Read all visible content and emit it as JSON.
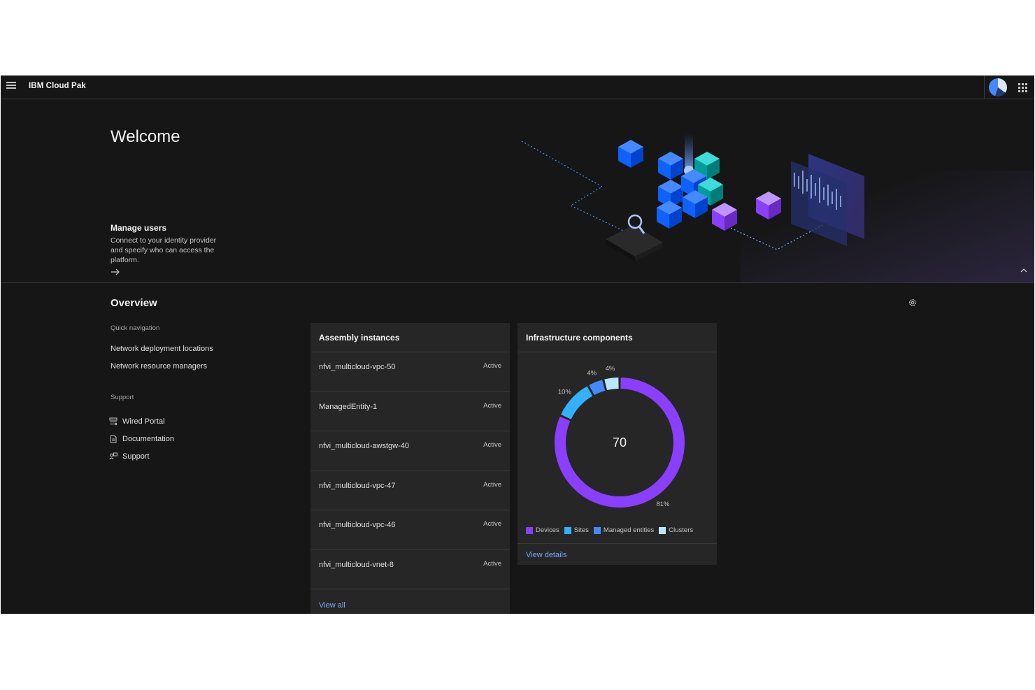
{
  "header": {
    "brand": "IBM Cloud Pak",
    "menu_icon": "hamburger-icon",
    "switcher_icon": "app-switcher-icon"
  },
  "banner": {
    "title": "Welcome",
    "manage_users": {
      "title": "Manage users",
      "description": "Connect to your identity provider and specify who can access the platform."
    }
  },
  "overview": {
    "title": "Overview",
    "quick_navigation": {
      "label": "Quick navigation",
      "links": [
        "Network deployment locations",
        "Network resource managers"
      ]
    },
    "support": {
      "label": "Support",
      "links": [
        {
          "label": "Wired Portal",
          "icon": "portal-icon"
        },
        {
          "label": "Documentation",
          "icon": "document-icon"
        },
        {
          "label": "Support",
          "icon": "support-icon"
        }
      ]
    }
  },
  "assembly": {
    "title": "Assembly instances",
    "rows": [
      {
        "name": "nfvi_multicloud-vpc-50",
        "status": "Active"
      },
      {
        "name": "ManagedEntity-1",
        "status": "Active"
      },
      {
        "name": "nfvi_multicloud-awstgw-40",
        "status": "Active"
      },
      {
        "name": "nfvi_multicloud-vpc-47",
        "status": "Active"
      },
      {
        "name": "nfvi_multicloud-vpc-46",
        "status": "Active"
      },
      {
        "name": "nfvi_multicloud-vnet-8",
        "status": "Active"
      }
    ],
    "view_all": "View all"
  },
  "infra": {
    "title": "Infrastructure components",
    "view_details": "View details"
  },
  "chart_data": {
    "type": "pie",
    "center_label": "70",
    "categories": [
      "Devices",
      "Sites",
      "Managed entities",
      "Clusters"
    ],
    "values": [
      81,
      10,
      4,
      4
    ],
    "value_labels": [
      "81%",
      "10%",
      "4%",
      "4%"
    ],
    "colors": [
      "#8a3ffc",
      "#33b1ff",
      "#4589ff",
      "#bae6ff"
    ],
    "legend": "bottom"
  }
}
